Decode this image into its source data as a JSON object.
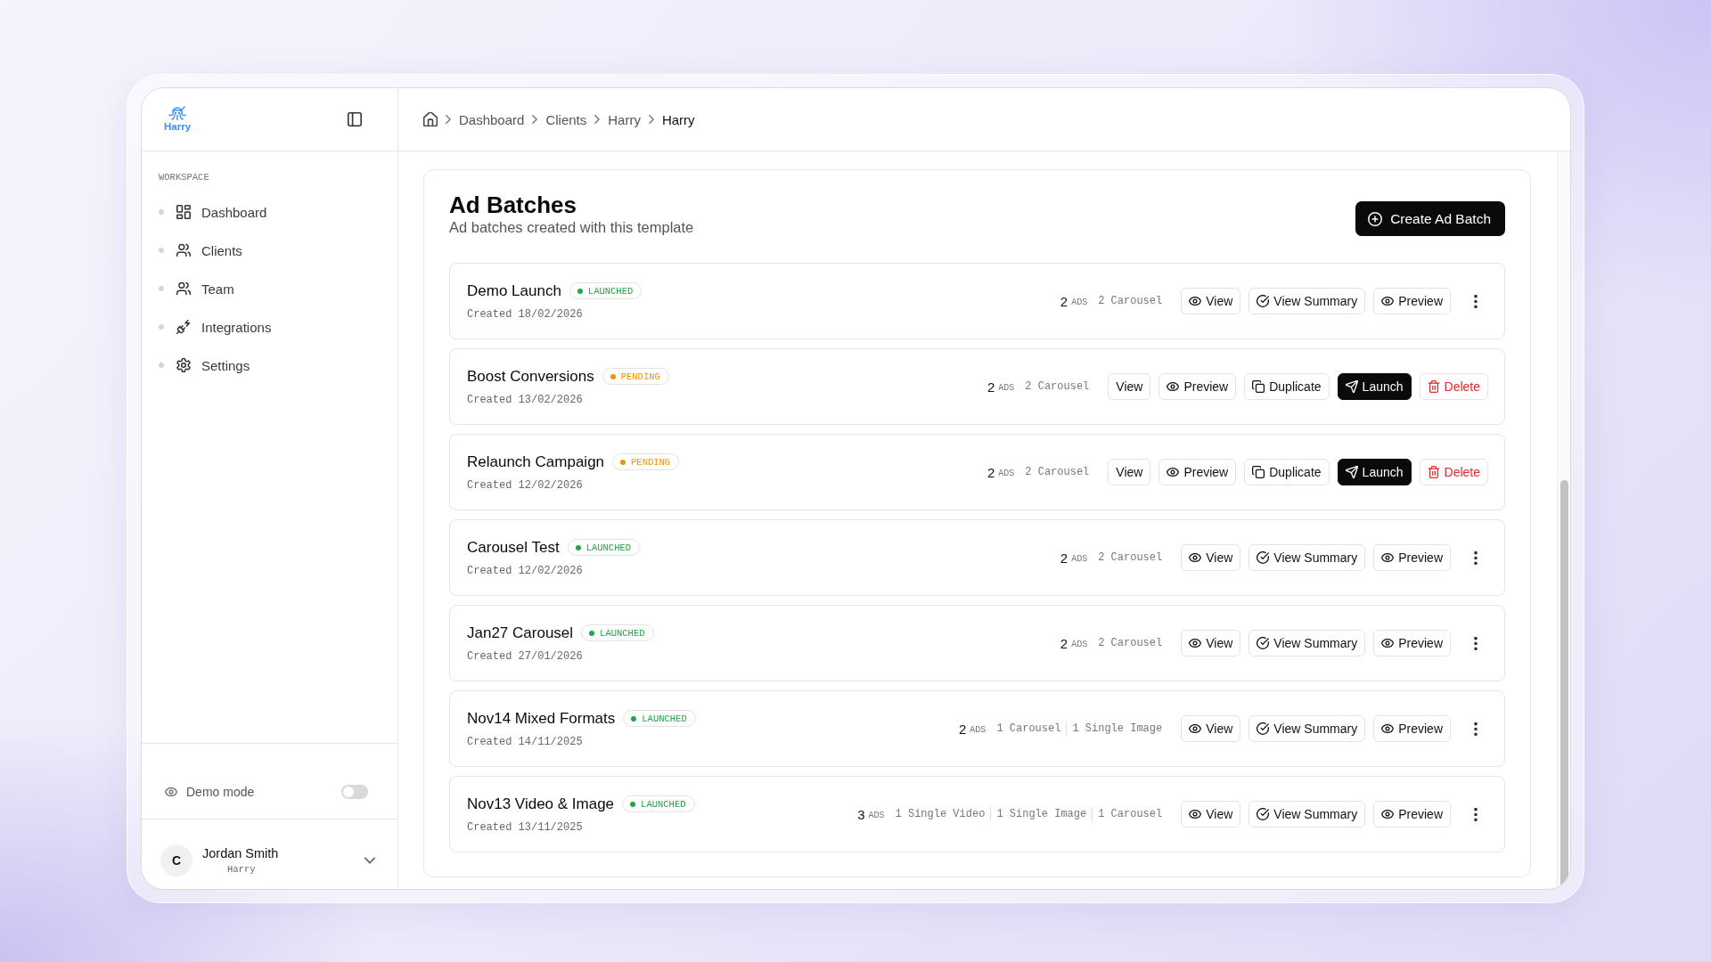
{
  "sidebar": {
    "logo_text": "Harry",
    "section_label": "WORKSPACE",
    "items": [
      {
        "label": "Dashboard",
        "selected": false
      },
      {
        "label": "Clients",
        "selected": false
      },
      {
        "label": "Team",
        "selected": false
      },
      {
        "label": "Integrations",
        "selected": false
      },
      {
        "label": "Settings",
        "selected": false
      }
    ],
    "demo_mode": {
      "label": "Demo mode",
      "on": false
    },
    "user": {
      "avatar": "C",
      "name": "Jordan Smith",
      "subtitle": "Harry"
    }
  },
  "breadcrumb": [
    {
      "label": "Dashboard",
      "current": false
    },
    {
      "label": "Clients",
      "current": false
    },
    {
      "label": "Harry",
      "current": false
    },
    {
      "label": "Harry",
      "current": true
    }
  ],
  "page": {
    "title": "Ad Batches",
    "subtitle": "Ad batches created with this template",
    "create_button": "Create Ad Batch"
  },
  "batches": [
    {
      "name": "Demo Launch",
      "status": {
        "label": "LAUNCHED",
        "color": "#22a447"
      },
      "created": "Created 18/02/2026",
      "count": "2",
      "count_unit": "ADS",
      "formats": [
        "2 Carousel"
      ],
      "actions": [
        {
          "kind": "view",
          "label": "View"
        },
        {
          "kind": "summary",
          "label": "View Summary"
        },
        {
          "kind": "preview",
          "label": "Preview"
        },
        {
          "kind": "more"
        }
      ]
    },
    {
      "name": "Boost Conversions",
      "status": {
        "label": "PENDING",
        "color": "#f0930a"
      },
      "created": "Created 13/02/2026",
      "count": "2",
      "count_unit": "ADS",
      "formats": [
        "2 Carousel"
      ],
      "actions": [
        {
          "kind": "plain",
          "label": "View"
        },
        {
          "kind": "preview",
          "label": "Preview"
        },
        {
          "kind": "duplicate",
          "label": "Duplicate"
        },
        {
          "kind": "launch",
          "label": "Launch"
        },
        {
          "kind": "delete",
          "label": "Delete"
        }
      ]
    },
    {
      "name": "Relaunch Campaign",
      "status": {
        "label": "PENDING",
        "color": "#f0930a"
      },
      "created": "Created 12/02/2026",
      "count": "2",
      "count_unit": "ADS",
      "formats": [
        "2 Carousel"
      ],
      "actions": [
        {
          "kind": "plain",
          "label": "View"
        },
        {
          "kind": "preview",
          "label": "Preview"
        },
        {
          "kind": "duplicate",
          "label": "Duplicate"
        },
        {
          "kind": "launch",
          "label": "Launch"
        },
        {
          "kind": "delete",
          "label": "Delete"
        }
      ]
    },
    {
      "name": "Carousel Test",
      "status": {
        "label": "LAUNCHED",
        "color": "#22a447"
      },
      "created": "Created 12/02/2026",
      "count": "2",
      "count_unit": "ADS",
      "formats": [
        "2 Carousel"
      ],
      "actions": [
        {
          "kind": "view",
          "label": "View"
        },
        {
          "kind": "summary",
          "label": "View Summary"
        },
        {
          "kind": "preview",
          "label": "Preview"
        },
        {
          "kind": "more"
        }
      ]
    },
    {
      "name": "Jan27 Carousel",
      "status": {
        "label": "LAUNCHED",
        "color": "#22a447"
      },
      "created": "Created 27/01/2026",
      "count": "2",
      "count_unit": "ADS",
      "formats": [
        "2 Carousel"
      ],
      "actions": [
        {
          "kind": "view",
          "label": "View"
        },
        {
          "kind": "summary",
          "label": "View Summary"
        },
        {
          "kind": "preview",
          "label": "Preview"
        },
        {
          "kind": "more"
        }
      ]
    },
    {
      "name": "Nov14 Mixed Formats",
      "status": {
        "label": "LAUNCHED",
        "color": "#22a447"
      },
      "created": "Created 14/11/2025",
      "count": "2",
      "count_unit": "ADS",
      "formats": [
        "1 Carousel",
        "1 Single Image"
      ],
      "actions": [
        {
          "kind": "view",
          "label": "View"
        },
        {
          "kind": "summary",
          "label": "View Summary"
        },
        {
          "kind": "preview",
          "label": "Preview"
        },
        {
          "kind": "more"
        }
      ]
    },
    {
      "name": "Nov13 Video & Image",
      "status": {
        "label": "LAUNCHED",
        "color": "#22a447"
      },
      "created": "Created 13/11/2025",
      "count": "3",
      "count_unit": "ADS",
      "formats": [
        "1 Single Video",
        "1 Single Image",
        "1 Carousel"
      ],
      "actions": [
        {
          "kind": "view",
          "label": "View"
        },
        {
          "kind": "summary",
          "label": "View Summary"
        },
        {
          "kind": "preview",
          "label": "Preview"
        },
        {
          "kind": "more"
        }
      ]
    }
  ]
}
